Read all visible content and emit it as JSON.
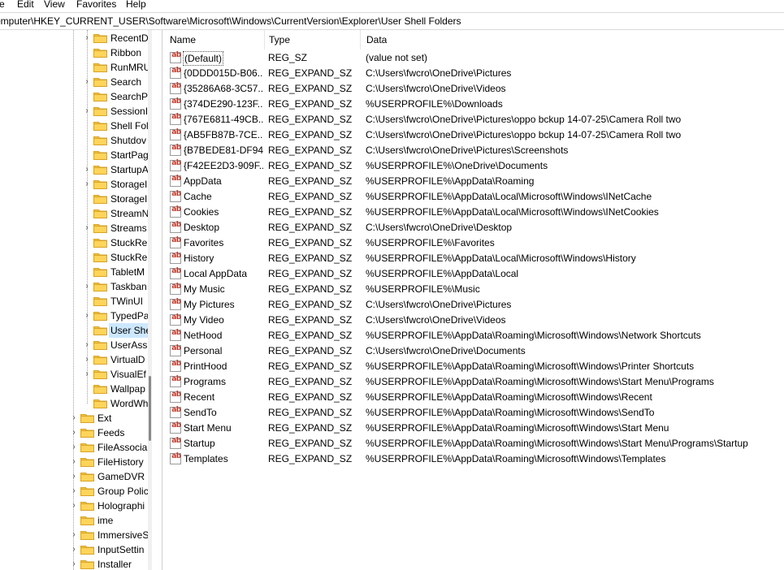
{
  "menu": [
    "e",
    "Edit",
    "View",
    "Favorites",
    "Help"
  ],
  "address": "omputer\\HKEY_CURRENT_USER\\Software\\Microsoft\\Windows\\CurrentVersion\\Explorer\\User Shell Folders",
  "columns": {
    "name": "Name",
    "type": "Type",
    "data": "Data"
  },
  "tree_items": [
    "RecentD",
    "Ribbon",
    "RunMRU",
    "Search",
    "SearchP",
    "SessionI",
    "Shell Fol",
    "Shutdov",
    "StartPag",
    "StartupA",
    "StorageI",
    "StorageI",
    "StreamN",
    "Streams",
    "StuckRe",
    "StuckRe",
    "TabletM",
    "Taskban",
    "TWinUI",
    "TypedPa",
    "User She",
    "UserAssi",
    "VirtualD",
    "VisualEf",
    "Wallpap",
    "WordWh",
    "Ext",
    "Feeds",
    "FileAssocia",
    "FileHistory",
    "GameDVR",
    "Group Polic",
    "Holographi",
    "ime",
    "ImmersiveS",
    "InputSettin",
    "Installer"
  ],
  "values": [
    {
      "name": "(Default)",
      "type": "REG_SZ",
      "data": "(value not set)"
    },
    {
      "name": "{0DDD015D-B06...",
      "type": "REG_EXPAND_SZ",
      "data": "C:\\Users\\fwcro\\OneDrive\\Pictures"
    },
    {
      "name": "{35286A68-3C57...",
      "type": "REG_EXPAND_SZ",
      "data": "C:\\Users\\fwcro\\OneDrive\\Videos"
    },
    {
      "name": "{374DE290-123F...",
      "type": "REG_EXPAND_SZ",
      "data": "%USERPROFILE%\\Downloads"
    },
    {
      "name": "{767E6811-49CB...",
      "type": "REG_EXPAND_SZ",
      "data": "C:\\Users\\fwcro\\OneDrive\\Pictures\\oppo bckup 14-07-25\\Camera Roll two"
    },
    {
      "name": "{AB5FB87B-7CE...",
      "type": "REG_EXPAND_SZ",
      "data": "C:\\Users\\fwcro\\OneDrive\\Pictures\\oppo bckup 14-07-25\\Camera Roll two"
    },
    {
      "name": "{B7BEDE81-DF94...",
      "type": "REG_EXPAND_SZ",
      "data": "C:\\Users\\fwcro\\OneDrive\\Pictures\\Screenshots"
    },
    {
      "name": "{F42EE2D3-909F...",
      "type": "REG_EXPAND_SZ",
      "data": "%USERPROFILE%\\OneDrive\\Documents"
    },
    {
      "name": "AppData",
      "type": "REG_EXPAND_SZ",
      "data": "%USERPROFILE%\\AppData\\Roaming"
    },
    {
      "name": "Cache",
      "type": "REG_EXPAND_SZ",
      "data": "%USERPROFILE%\\AppData\\Local\\Microsoft\\Windows\\INetCache"
    },
    {
      "name": "Cookies",
      "type": "REG_EXPAND_SZ",
      "data": "%USERPROFILE%\\AppData\\Local\\Microsoft\\Windows\\INetCookies"
    },
    {
      "name": "Desktop",
      "type": "REG_EXPAND_SZ",
      "data": "C:\\Users\\fwcro\\OneDrive\\Desktop"
    },
    {
      "name": "Favorites",
      "type": "REG_EXPAND_SZ",
      "data": "%USERPROFILE%\\Favorites"
    },
    {
      "name": "History",
      "type": "REG_EXPAND_SZ",
      "data": "%USERPROFILE%\\AppData\\Local\\Microsoft\\Windows\\History"
    },
    {
      "name": "Local AppData",
      "type": "REG_EXPAND_SZ",
      "data": "%USERPROFILE%\\AppData\\Local"
    },
    {
      "name": "My Music",
      "type": "REG_EXPAND_SZ",
      "data": "%USERPROFILE%\\Music"
    },
    {
      "name": "My Pictures",
      "type": "REG_EXPAND_SZ",
      "data": "C:\\Users\\fwcro\\OneDrive\\Pictures"
    },
    {
      "name": "My Video",
      "type": "REG_EXPAND_SZ",
      "data": "C:\\Users\\fwcro\\OneDrive\\Videos"
    },
    {
      "name": "NetHood",
      "type": "REG_EXPAND_SZ",
      "data": "%USERPROFILE%\\AppData\\Roaming\\Microsoft\\Windows\\Network Shortcuts"
    },
    {
      "name": "Personal",
      "type": "REG_EXPAND_SZ",
      "data": "C:\\Users\\fwcro\\OneDrive\\Documents"
    },
    {
      "name": "PrintHood",
      "type": "REG_EXPAND_SZ",
      "data": "%USERPROFILE%\\AppData\\Roaming\\Microsoft\\Windows\\Printer Shortcuts"
    },
    {
      "name": "Programs",
      "type": "REG_EXPAND_SZ",
      "data": "%USERPROFILE%\\AppData\\Roaming\\Microsoft\\Windows\\Start Menu\\Programs"
    },
    {
      "name": "Recent",
      "type": "REG_EXPAND_SZ",
      "data": "%USERPROFILE%\\AppData\\Roaming\\Microsoft\\Windows\\Recent"
    },
    {
      "name": "SendTo",
      "type": "REG_EXPAND_SZ",
      "data": "%USERPROFILE%\\AppData\\Roaming\\Microsoft\\Windows\\SendTo"
    },
    {
      "name": "Start Menu",
      "type": "REG_EXPAND_SZ",
      "data": "%USERPROFILE%\\AppData\\Roaming\\Microsoft\\Windows\\Start Menu"
    },
    {
      "name": "Startup",
      "type": "REG_EXPAND_SZ",
      "data": "%USERPROFILE%\\AppData\\Roaming\\Microsoft\\Windows\\Start Menu\\Programs\\Startup"
    },
    {
      "name": "Templates",
      "type": "REG_EXPAND_SZ",
      "data": "%USERPROFILE%\\AppData\\Roaming\\Microsoft\\Windows\\Templates"
    }
  ],
  "value_icon": "ab",
  "colors": {
    "folder": "#f5c542",
    "selection": "#cce8ff",
    "ab_icon": "#c0392b"
  }
}
